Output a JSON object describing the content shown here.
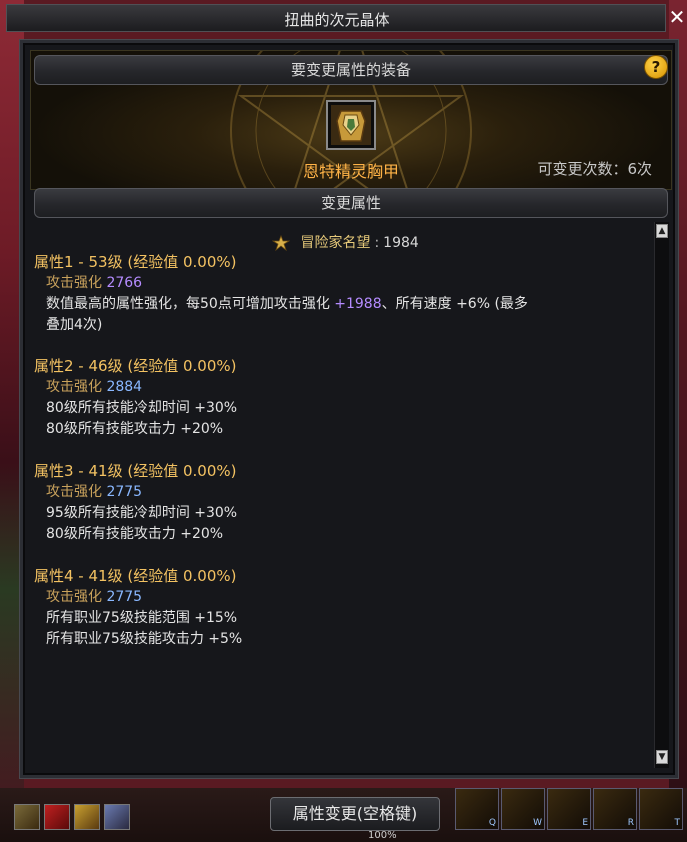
{
  "window": {
    "title": "扭曲的次元晶体",
    "close_symbol": "✕"
  },
  "equipment_section": {
    "header": "要变更属性的装备",
    "help_symbol": "?",
    "item_name": "恩特精灵胸甲",
    "change_count": "可变更次数：6次"
  },
  "attribute_section": {
    "header": "变更属性",
    "fame_label": "冒险家名望",
    "fame_separator": ":",
    "fame_value": "1984",
    "blocks": [
      {
        "title": "属性1 - 53级 (经验值 0.00%)",
        "stat_label": "攻击强化",
        "stat_value": "2766",
        "desc1_a": "数值最高的属性强化，每50点可增加攻击强化 ",
        "desc1_b": "+1988",
        "desc1_c": "、所有速度 +6% (最多",
        "desc2": "叠加4次)"
      },
      {
        "title": "属性2 - 46级 (经验值 0.00%)",
        "stat_label": "攻击强化",
        "stat_value": "2884",
        "desc1": "80级所有技能冷却时间 +30%",
        "desc2": "80级所有技能攻击力 +20%"
      },
      {
        "title": "属性3 - 41级 (经验值 0.00%)",
        "stat_label": "攻击强化",
        "stat_value": "2775",
        "desc1": "95级所有技能冷却时间 +30%",
        "desc2": "80级所有技能攻击力 +20%"
      },
      {
        "title": "属性4 - 41级 (经验值 0.00%)",
        "stat_label": "攻击强化",
        "stat_value": "2775",
        "desc1": "所有职业75级技能范围 +15%",
        "desc2": "所有职业75级技能攻击力 +5%"
      }
    ]
  },
  "footer": {
    "confirm_button": "属性变更(空格键)",
    "percent_text": "100%",
    "skill_keys": [
      "Q",
      "W",
      "E",
      "R",
      "T"
    ]
  },
  "icons": {
    "item": "chestplate-icon",
    "fame": "fame-emblem-icon",
    "help": "help-icon",
    "close": "close-icon"
  },
  "colors": {
    "item_name": "#ffb347",
    "attr_title": "#f3c262",
    "stat_value_blue": "#8ab8ff",
    "highlight_purple": "#b58cff"
  }
}
